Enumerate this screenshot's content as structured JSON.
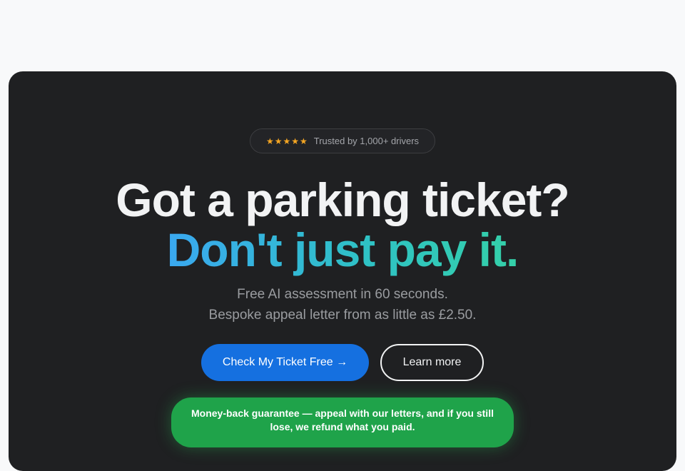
{
  "trust": {
    "stars": "★★★★★",
    "text": "Trusted by 1,000+ drivers"
  },
  "headline": {
    "line1": "Got a parking ticket?",
    "line2": "Don't just pay it."
  },
  "subtitle": {
    "line1": "Free AI assessment in 60 seconds.",
    "line2": "Bespoke appeal letter from as little as £2.50."
  },
  "buttons": {
    "primary": "Check My Ticket Free →",
    "secondary": "Learn more"
  },
  "guarantee": {
    "text": "Money-back guarantee — appeal with our letters, and if you still lose, we refund what you paid."
  },
  "colors": {
    "page_bg": "#f8f9fa",
    "hero_bg": "#1f2022",
    "primary_button": "#1570e0",
    "guarantee_bg": "#1fa34a",
    "star": "#f5a623",
    "gradient_start": "#3aa8f0",
    "gradient_end": "#34d0a8"
  }
}
